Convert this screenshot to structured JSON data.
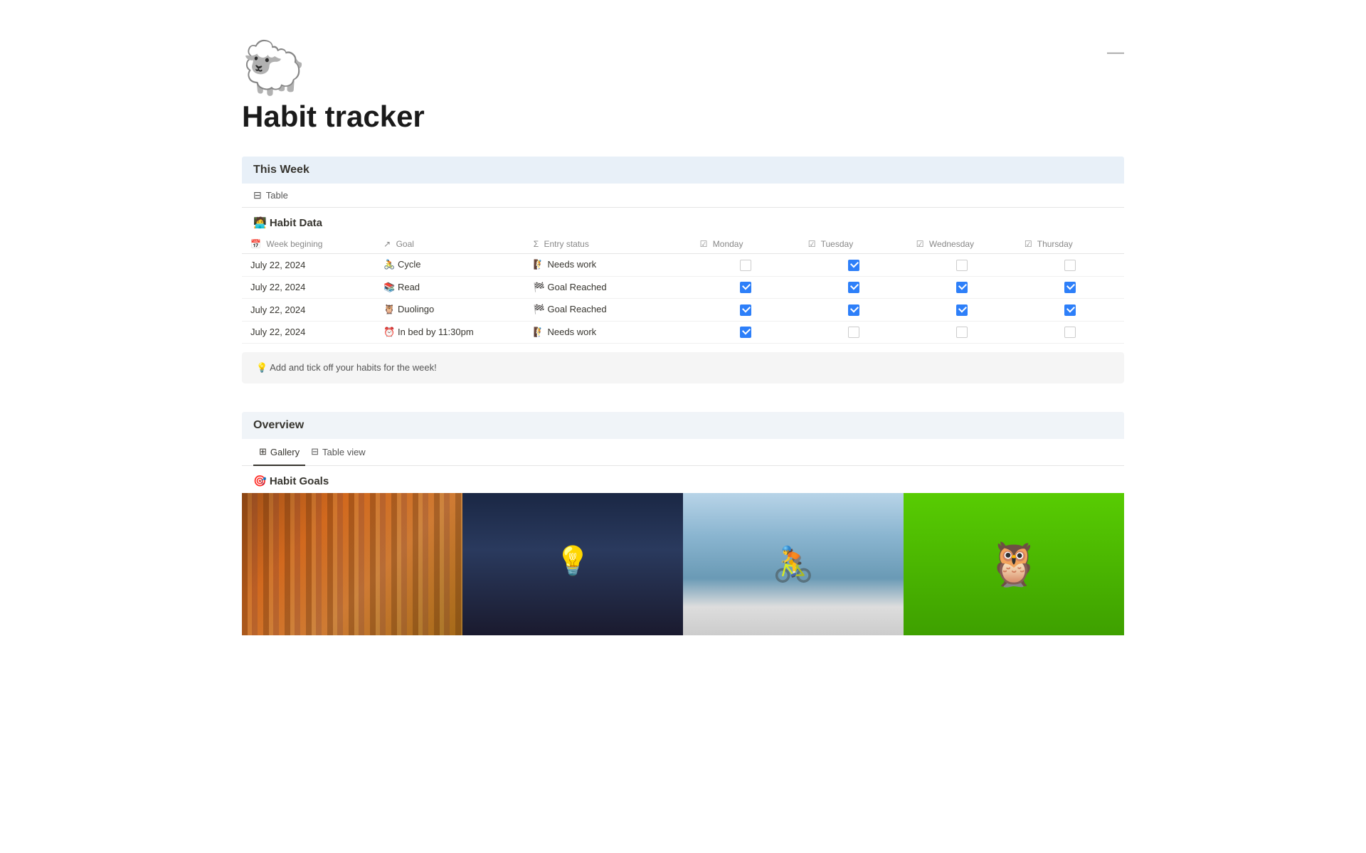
{
  "page": {
    "icon": "🐑",
    "title": "Habit tracker",
    "minimize_label": "—"
  },
  "this_week_section": {
    "header": "This Week",
    "view_label": "Table",
    "sub_header": "🧑‍💻 Habit Data",
    "columns": [
      {
        "icon": "📅",
        "label": "Week begining"
      },
      {
        "icon": "↗",
        "label": "Goal"
      },
      {
        "icon": "Σ",
        "label": "Entry status"
      },
      {
        "icon": "☑",
        "label": "Monday"
      },
      {
        "icon": "☑",
        "label": "Tuesday"
      },
      {
        "icon": "☑",
        "label": "Wednesday"
      },
      {
        "icon": "☑",
        "label": "Thursday"
      }
    ],
    "rows": [
      {
        "week": "July 22, 2024",
        "goal_icon": "🚴",
        "goal": "Cycle",
        "status_icon": "🧗",
        "status": "Needs work",
        "monday": false,
        "tuesday": true,
        "wednesday": false,
        "thursday": false
      },
      {
        "week": "July 22, 2024",
        "goal_icon": "📚",
        "goal": "Read",
        "status_icon": "🏁",
        "status": "Goal Reached",
        "monday": true,
        "tuesday": true,
        "wednesday": true,
        "thursday": true
      },
      {
        "week": "July 22, 2024",
        "goal_icon": "🦉",
        "goal": "Duolingo",
        "status_icon": "🏁",
        "status": "Goal Reached",
        "monday": true,
        "tuesday": true,
        "wednesday": true,
        "thursday": true
      },
      {
        "week": "July 22, 2024",
        "goal_icon": "⏰",
        "goal": "In bed by 11:30pm",
        "status_icon": "🧗",
        "status": "Needs work",
        "monday": true,
        "tuesday": false,
        "wednesday": false,
        "thursday": false
      }
    ],
    "hint": "💡  Add and tick off your habits for the week!"
  },
  "overview_section": {
    "header": "Overview",
    "tabs": [
      {
        "icon": "⊞",
        "label": "Gallery",
        "active": true
      },
      {
        "icon": "⊟",
        "label": "Table view",
        "active": false
      }
    ],
    "goals_sub_header": "🎯 Habit Goals",
    "cards": [
      {
        "type": "books",
        "label": "Books"
      },
      {
        "type": "lamp",
        "label": "Lamp"
      },
      {
        "type": "cycling",
        "label": "Cycling"
      },
      {
        "type": "duolingo",
        "label": "Duolingo"
      }
    ]
  }
}
